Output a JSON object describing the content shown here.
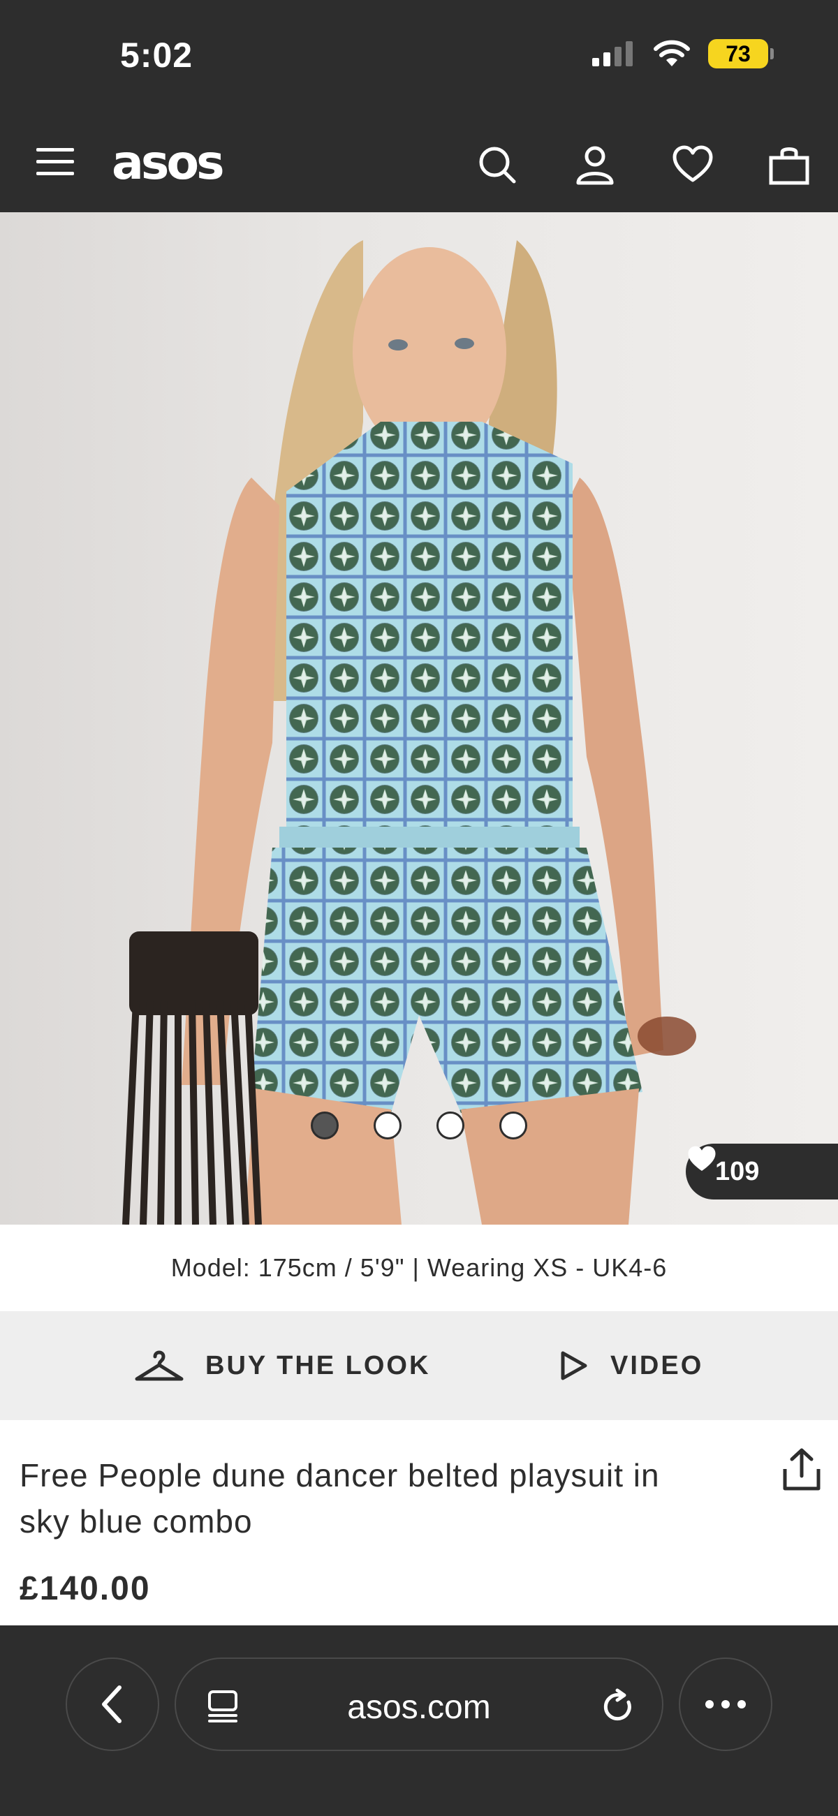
{
  "status_bar": {
    "time": "5:02",
    "battery": "73"
  },
  "header": {
    "logo": "asos",
    "icons": [
      "menu-icon",
      "search-icon",
      "account-icon",
      "heart-icon",
      "bag-icon"
    ]
  },
  "gallery": {
    "image_count": 4,
    "active_index": 0,
    "likes": "109"
  },
  "model_info": "Model: 175cm / 5'9\" | Wearing XS - UK4-6",
  "actions": {
    "buy_the_look": "BUY THE LOOK",
    "video": "VIDEO"
  },
  "product": {
    "title": "Free People dune dancer belted playsuit in sky blue combo",
    "price": "£140.00"
  },
  "browser": {
    "url": "asos.com"
  },
  "colors": {
    "dark": "#2d2d2d",
    "battery": "#f6d51f",
    "print_blue": "#a9d8e6"
  }
}
